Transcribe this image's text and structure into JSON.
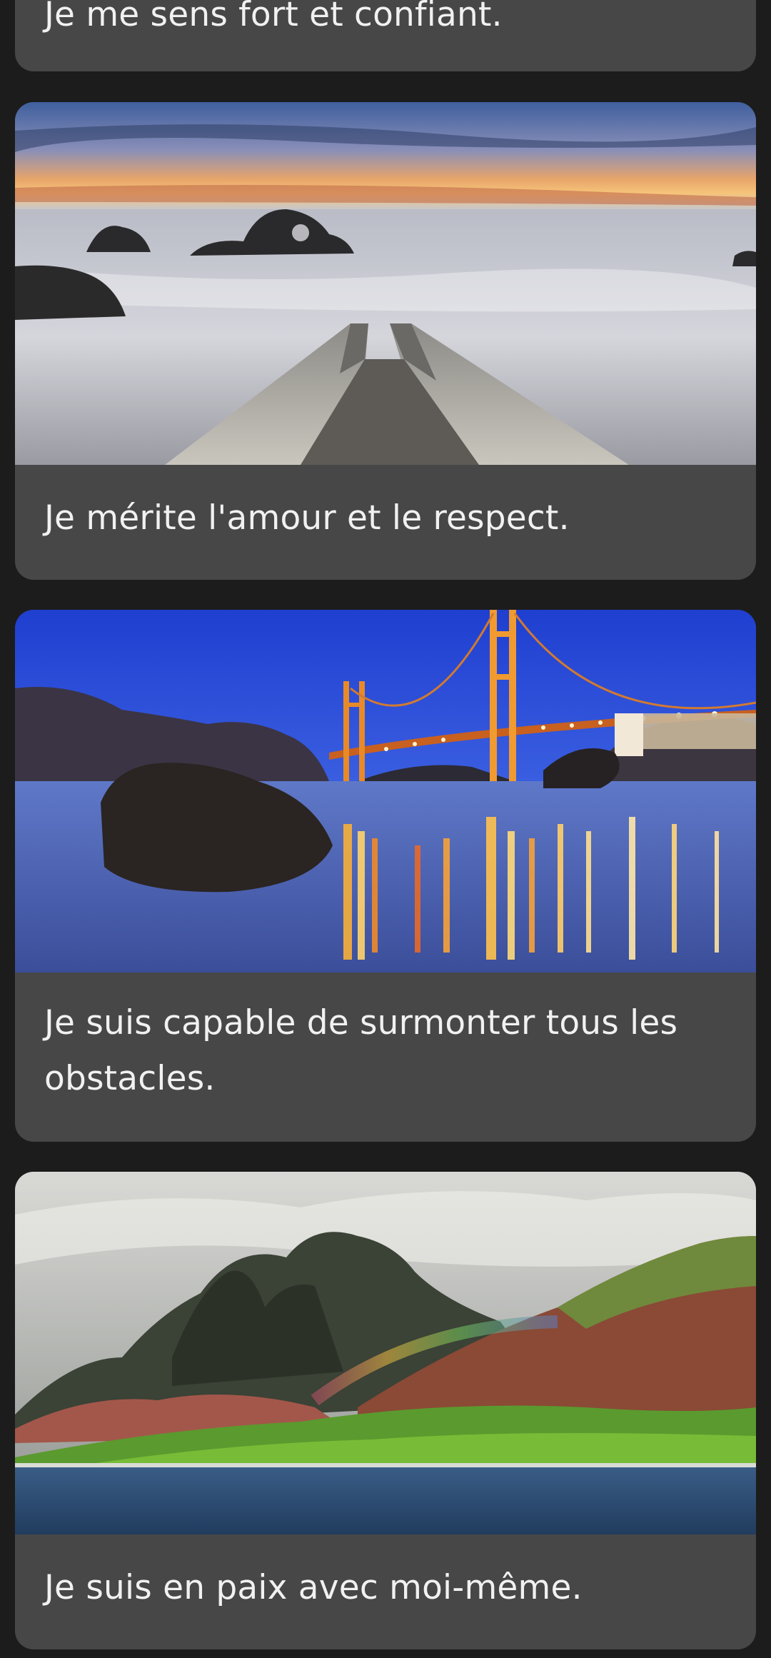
{
  "cards": [
    {
      "caption": "Je me sens fort et confiant.",
      "image": "sunset-pier-rocks-photo"
    },
    {
      "caption": "Je mérite l'amour et le respect.",
      "image": "sunset-pier-rocks-photo"
    },
    {
      "caption": "Je suis capable de surmonter tous les obstacles.",
      "image": "golden-gate-bridge-night-photo"
    },
    {
      "caption": "Je suis en paix avec moi-même.",
      "image": "mountain-rainbow-coast-photo"
    }
  ],
  "colors": {
    "background": "#1c1c1c",
    "card": "#474747",
    "caption_text": "#f1f1f1"
  }
}
